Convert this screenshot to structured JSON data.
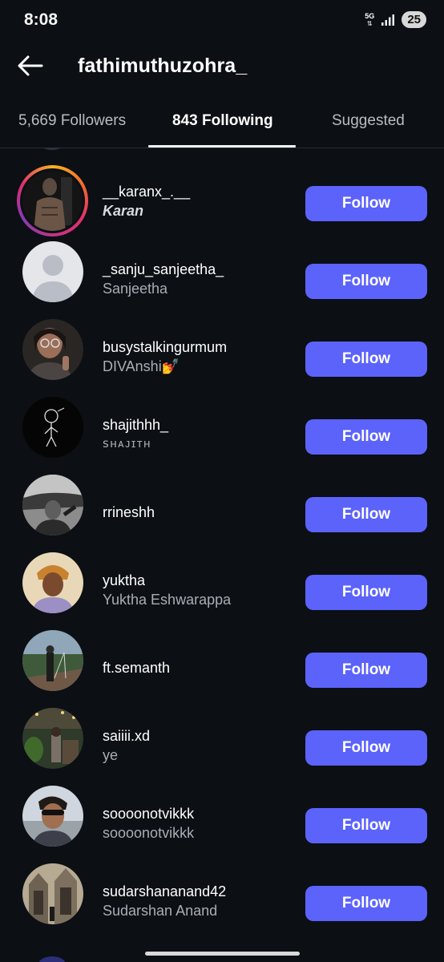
{
  "status_bar": {
    "time": "8:08",
    "network": "5G",
    "battery": "25"
  },
  "header": {
    "title": "fathimuthuzohra_"
  },
  "tabs": [
    {
      "label": "5,669 Followers"
    },
    {
      "label": "843 Following"
    },
    {
      "label": "Suggested"
    }
  ],
  "accounts": [
    {
      "username": "__karanx_.__",
      "name": "Karan",
      "follow": "Follow"
    },
    {
      "username": "_sanju_sanjeetha_",
      "name": "Sanjeetha",
      "follow": "Follow"
    },
    {
      "username": "busystalkingurmum",
      "name": "DIVAnshi💅",
      "follow": "Follow"
    },
    {
      "username": "shajithhh_",
      "name": "ꜱʜᴀᴊɪᴛʜ",
      "follow": "Follow"
    },
    {
      "username": "rrineshh",
      "name": "",
      "follow": "Follow"
    },
    {
      "username": "yuktha",
      "name": "Yuktha Eshwarappa",
      "follow": "Follow"
    },
    {
      "username": "ft.semanth",
      "name": "",
      "follow": "Follow"
    },
    {
      "username": "saiiii.xd",
      "name": "ye",
      "follow": "Follow"
    },
    {
      "username": "soooonotvikkk",
      "name": "soooonotvikkk",
      "follow": "Follow"
    },
    {
      "username": "sudarshananand42",
      "name": "Sudarshan Anand",
      "follow": "Follow"
    }
  ]
}
